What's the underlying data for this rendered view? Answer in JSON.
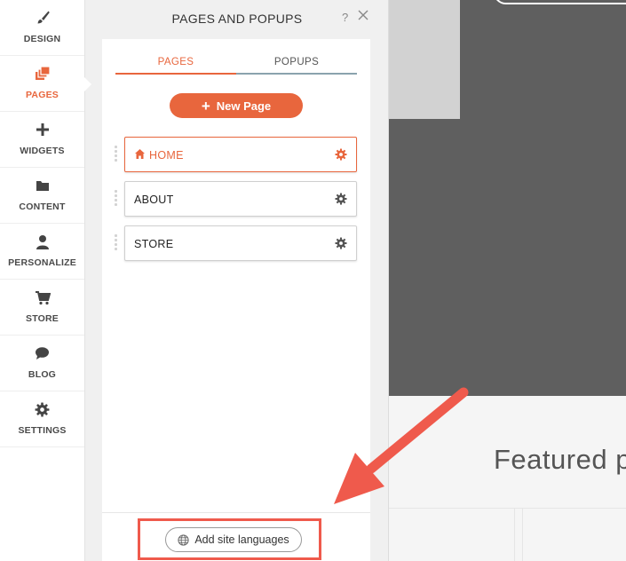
{
  "nav": {
    "items": [
      {
        "label": "DESIGN",
        "icon": "brush-icon"
      },
      {
        "label": "PAGES",
        "icon": "pages-icon",
        "active": true
      },
      {
        "label": "WIDGETS",
        "icon": "plus-icon"
      },
      {
        "label": "CONTENT",
        "icon": "folder-icon"
      },
      {
        "label": "PERSONALIZE",
        "icon": "person-icon"
      },
      {
        "label": "STORE",
        "icon": "cart-icon"
      },
      {
        "label": "BLOG",
        "icon": "chat-bubble-icon"
      },
      {
        "label": "SETTINGS",
        "icon": "gear-icon"
      }
    ]
  },
  "panel": {
    "title": "PAGES AND POPUPS",
    "help": "?",
    "tabs": [
      {
        "label": "PAGES",
        "active": true
      },
      {
        "label": "POPUPS"
      }
    ],
    "new_page_label": "New Page",
    "pages": [
      {
        "name": "HOME",
        "is_home": true,
        "active": true
      },
      {
        "name": "ABOUT"
      },
      {
        "name": "STORE"
      }
    ],
    "add_languages_label": "Add site languages"
  },
  "preview": {
    "featured_text": "Featured p"
  },
  "colors": {
    "accent": "#e8663d",
    "annotation": "#ef5a4c",
    "tab_inactive_underline": "#8aa3ad",
    "hero_bg": "#5f5f5f"
  }
}
